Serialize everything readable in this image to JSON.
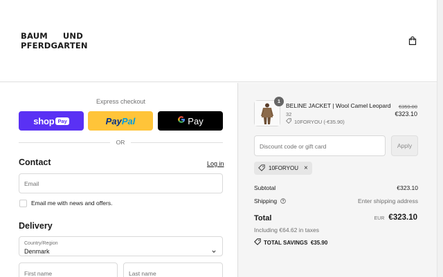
{
  "brand": {
    "line1_left": "BAUM",
    "line1_right": "UND",
    "line2": "PFERDGARTEN"
  },
  "express": {
    "label": "Express checkout",
    "shop_word": "shop",
    "shop_pay": "Pay",
    "paypal_1": "Pay",
    "paypal_2": "Pal",
    "gpay": "Pay"
  },
  "divider": "OR",
  "contact": {
    "heading": "Contact",
    "login": "Log in",
    "email_placeholder": "Email",
    "newsletter": "Email me with news and offers."
  },
  "delivery": {
    "heading": "Delivery",
    "country_label": "Country/Region",
    "country_value": "Denmark",
    "first_name_placeholder": "First name",
    "last_name_placeholder": "Last name"
  },
  "product": {
    "quantity": "1",
    "name": "BELINE JACKET | Wool Camel Leopard",
    "size": "32",
    "discount": "10FORYOU (-€35.90)",
    "old_price": "€359.00",
    "price": "€323.10"
  },
  "discount": {
    "placeholder": "Discount code or gift card",
    "apply": "Apply",
    "applied_code": "10FORYOU"
  },
  "summary": {
    "subtotal_label": "Subtotal",
    "subtotal_value": "€323.10",
    "shipping_label": "Shipping",
    "shipping_value": "Enter shipping address",
    "total_label": "Total",
    "currency": "EUR",
    "total_value": "€323.10",
    "taxes": "Including €64.62 in taxes",
    "savings": "TOTAL SAVINGS  €35.90"
  },
  "colors": {
    "shop_pay": "#5a31f4",
    "paypal": "#ffc439",
    "google_pay": "#000000",
    "summary_bg": "#f5f5f5"
  },
  "icons": [
    "bag-icon",
    "google-g-icon",
    "checkbox",
    "chevron-down-icon",
    "tag-icon",
    "close-icon",
    "help-icon",
    "savings-tag-icon"
  ]
}
